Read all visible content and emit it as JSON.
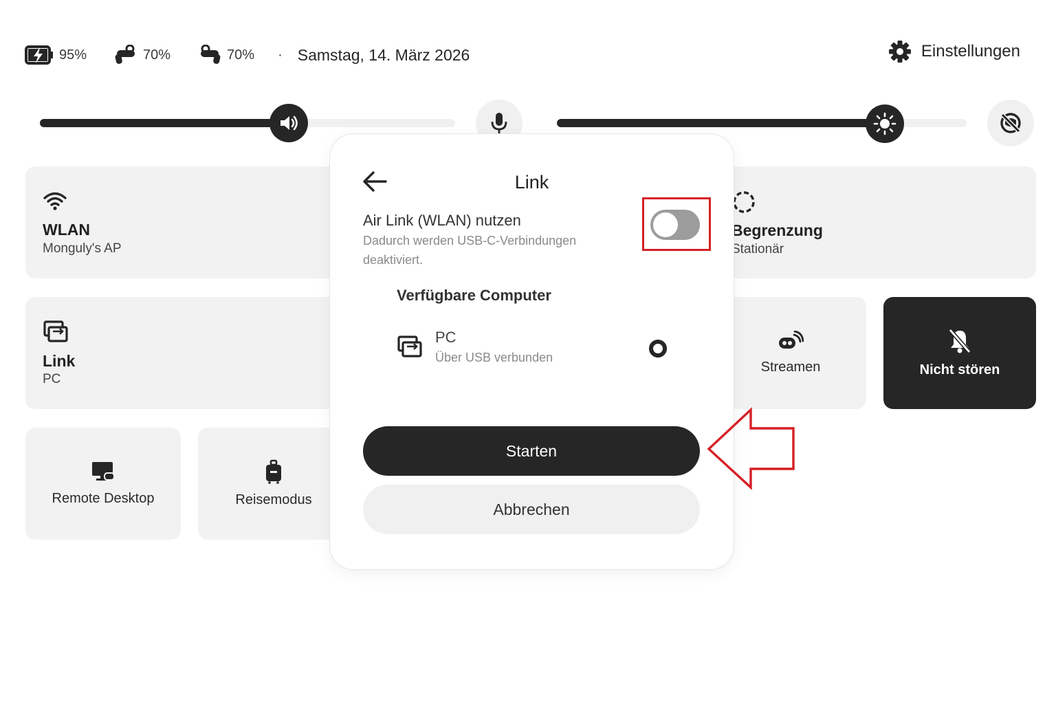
{
  "status_bar": {
    "headset_battery": "95%",
    "controller_left_battery": "70%",
    "controller_right_battery": "70%",
    "separator": "·",
    "date": "Samstag, 14. März 2026",
    "settings_label": "Einstellungen"
  },
  "sliders": {
    "volume_level": 0.6,
    "brightness_level": 0.8
  },
  "tiles": {
    "wlan": {
      "title": "WLAN",
      "subtitle": "Monguly's AP"
    },
    "boundary": {
      "title": "Begrenzung",
      "subtitle": "Stationär"
    },
    "link": {
      "title": "Link",
      "subtitle": "PC"
    },
    "stream": {
      "label": "Streamen"
    },
    "dnd": {
      "label": "Nicht stören"
    },
    "remote_desktop": {
      "label": "Remote Desktop"
    },
    "travel_mode": {
      "label": "Reisemodus"
    }
  },
  "dialog": {
    "title": "Link",
    "air_link_label": "Air Link (WLAN) nutzen",
    "air_link_desc_line1": "Dadurch werden USB-C-Verbindungen",
    "air_link_desc_line2": "deaktiviert.",
    "air_link_enabled": false,
    "available_heading": "Verfügbare Computer",
    "computers": [
      {
        "name": "PC",
        "status": "Über USB verbunden",
        "selected": true
      }
    ],
    "start_label": "Starten",
    "cancel_label": "Abbrechen"
  },
  "annotation_color": "#d61f26"
}
